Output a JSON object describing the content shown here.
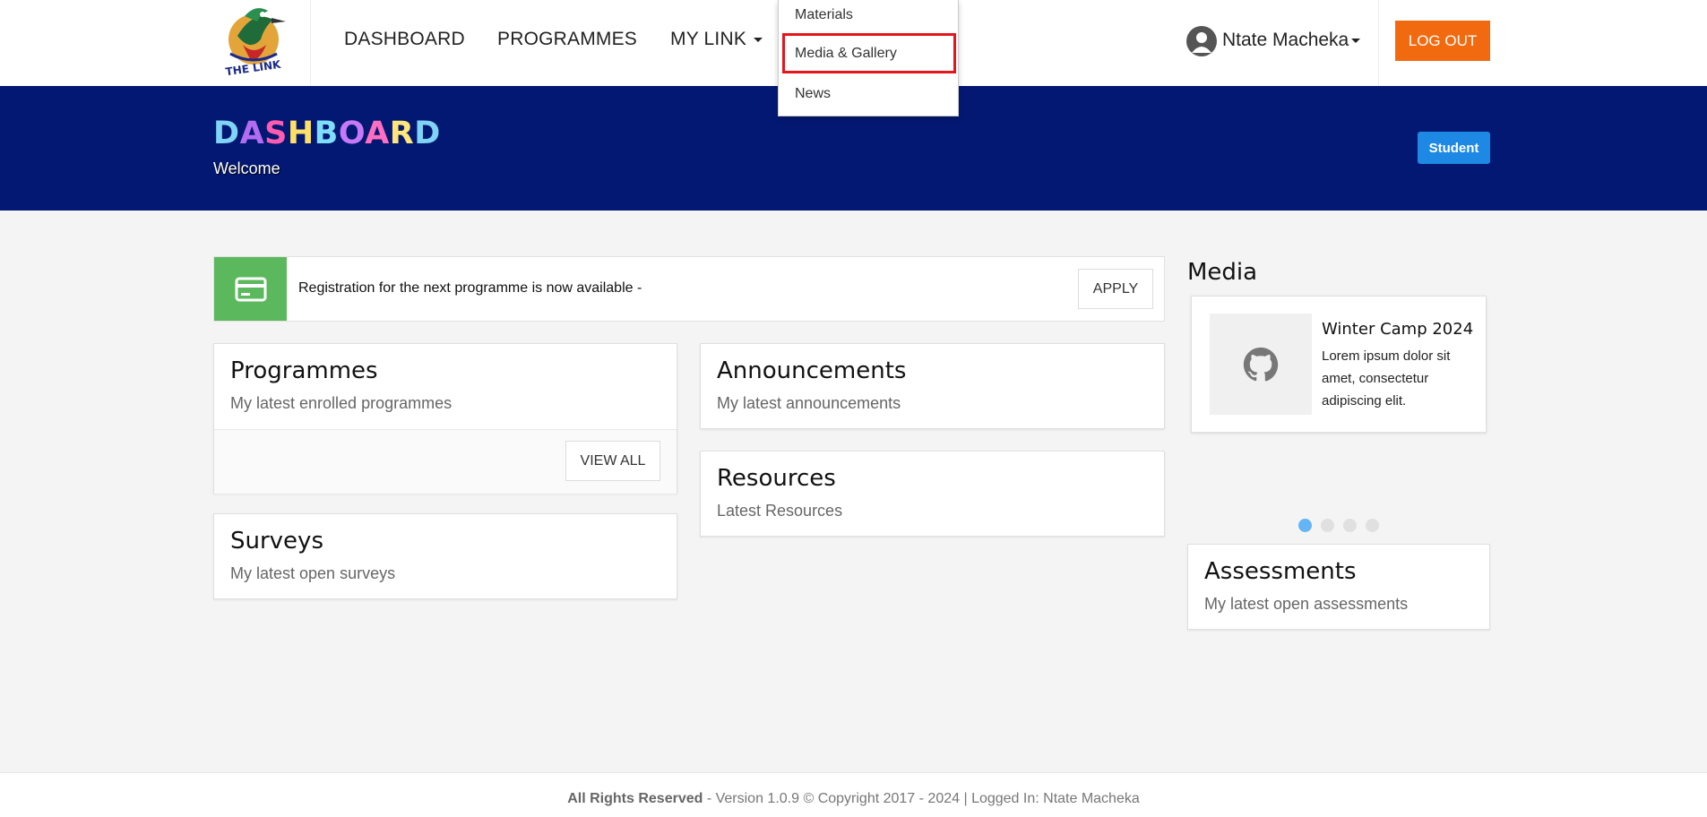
{
  "header": {
    "nav": [
      {
        "label": "DASHBOARD"
      },
      {
        "label": "PROGRAMMES"
      },
      {
        "label": "MY LINK"
      }
    ],
    "user_name": "Ntate Macheka",
    "logout_label": "LOG OUT",
    "logo_text": "THE LINK"
  },
  "dropdown": {
    "items": [
      {
        "label": "Materials"
      },
      {
        "label": "Media & Gallery",
        "highlighted": true
      },
      {
        "label": "News"
      }
    ]
  },
  "banner": {
    "title_letters": [
      {
        "char": "D",
        "color": "#7fd3f5"
      },
      {
        "char": "A",
        "color": "#b16cf0"
      },
      {
        "char": "S",
        "color": "#ff5bb0"
      },
      {
        "char": "H",
        "color": "#ffe066"
      },
      {
        "char": "B",
        "color": "#80ddf8"
      },
      {
        "char": "O",
        "color": "#c679f7"
      },
      {
        "char": "A",
        "color": "#ff6ec0"
      },
      {
        "char": "R",
        "color": "#ffe57a"
      },
      {
        "char": "D",
        "color": "#7fd3f5"
      }
    ],
    "subtitle": "Welcome",
    "role_badge": "Student"
  },
  "registration": {
    "text": "Registration for the next programme is now available -",
    "apply_label": "APPLY"
  },
  "cards": {
    "programmes": {
      "title": "Programmes",
      "subtitle": "My latest enrolled programmes",
      "button": "VIEW ALL"
    },
    "surveys": {
      "title": "Surveys",
      "subtitle": "My latest open surveys"
    },
    "announcements": {
      "title": "Announcements",
      "subtitle": "My latest announcements"
    },
    "resources": {
      "title": "Resources",
      "subtitle": "Latest Resources"
    },
    "assessments": {
      "title": "Assessments",
      "subtitle": "My latest open assessments"
    }
  },
  "media": {
    "heading": "Media",
    "item_title": "Winter Camp 2024",
    "item_text": "Lorem ipsum dolor sit amet, consectetur adipiscing elit.",
    "thumb_icon": "github-icon",
    "slides": 4,
    "active_slide": 1
  },
  "footer": {
    "bold": "All Rights Reserved",
    "text": " - Version 1.0.9 © Copyright 2017 - 2024 | Logged In: Ntate Macheka"
  },
  "colors": {
    "banner_bg": "#031873",
    "logout_bg": "#f26a10",
    "badge_bg": "#1e88e5",
    "reg_icon_bg": "#5cb85c",
    "highlight_border": "#e3161b"
  }
}
